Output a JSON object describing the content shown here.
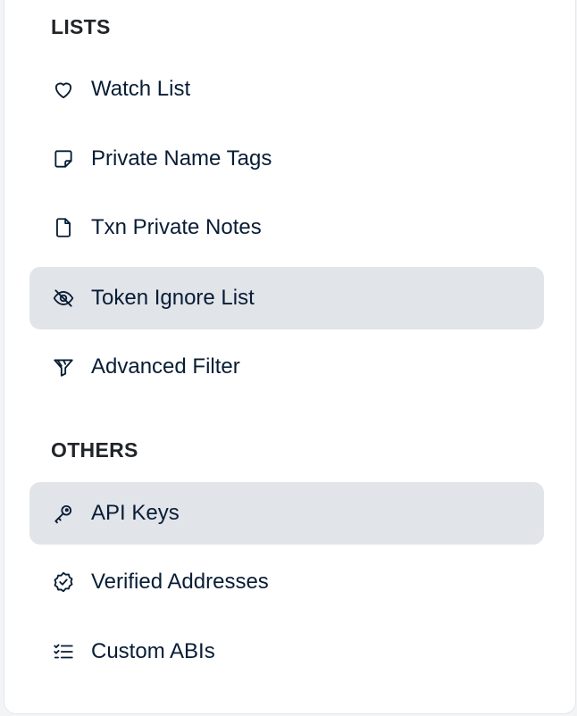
{
  "sections": {
    "lists": {
      "title": "LISTS",
      "items": [
        {
          "label": "Watch List",
          "icon": "heart-icon",
          "active": false
        },
        {
          "label": "Private Name Tags",
          "icon": "sticky-note-icon",
          "active": false
        },
        {
          "label": "Txn Private Notes",
          "icon": "file-icon",
          "active": false
        },
        {
          "label": "Token Ignore List",
          "icon": "eye-off-icon",
          "active": true
        },
        {
          "label": "Advanced Filter",
          "icon": "filter-icon",
          "active": false
        }
      ]
    },
    "others": {
      "title": "OTHERS",
      "items": [
        {
          "label": "API Keys",
          "icon": "key-icon",
          "active": true
        },
        {
          "label": "Verified Addresses",
          "icon": "badge-check-icon",
          "active": false
        },
        {
          "label": "Custom ABIs",
          "icon": "list-checks-icon",
          "active": false
        }
      ]
    }
  },
  "colors": {
    "text": "#081d35",
    "heading": "#212529",
    "active_bg": "#e1e4e9",
    "panel_bg": "#ffffff"
  }
}
